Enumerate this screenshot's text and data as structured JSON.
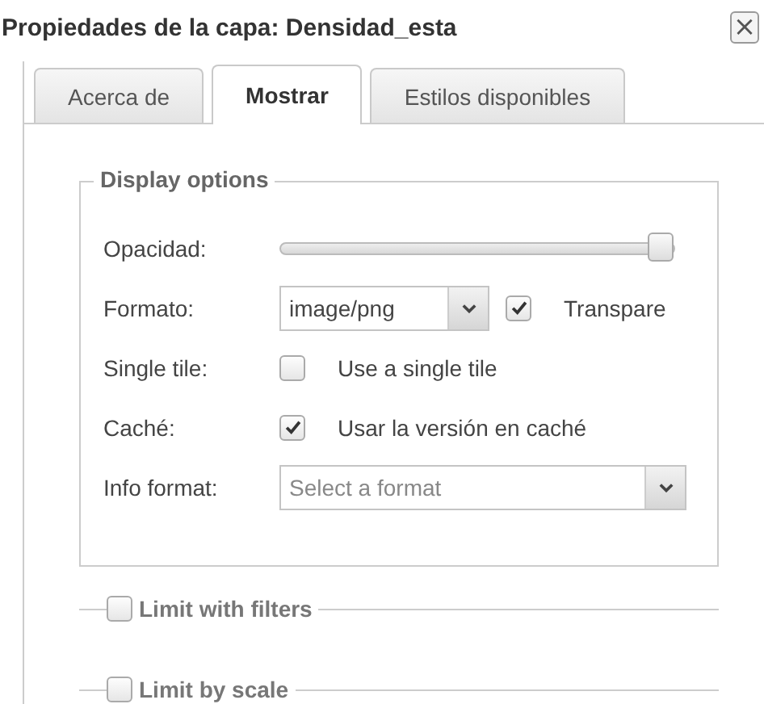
{
  "window": {
    "title": "Propiedades de la capa: Densidad_esta",
    "close": "×"
  },
  "tabs": [
    {
      "label": "Acerca de",
      "selected": false
    },
    {
      "label": "Mostrar",
      "selected": true
    },
    {
      "label": "Estilos disponibles",
      "selected": false
    }
  ],
  "display_options": {
    "legend": "Display options",
    "rows": [
      {
        "kind": "slider",
        "label": "Opacidad:",
        "level": 0.97
      },
      {
        "kind": "select",
        "label": "Formato:",
        "value": "image/png",
        "option": {
          "checked": true,
          "label": "Transpare"
        }
      },
      {
        "kind": "checkbox",
        "label": "Single tile:",
        "checked": false,
        "text": "Use a single tile"
      },
      {
        "kind": "checkbox",
        "label": "Caché:",
        "checked": true,
        "text": "Usar la versión en caché"
      },
      {
        "kind": "combo",
        "label": "Info format:",
        "placeholder": "Select a format"
      }
    ]
  },
  "sections": [
    {
      "label": "Limit with filters",
      "checked": false
    },
    {
      "label": "Limit by scale",
      "checked": false
    }
  ]
}
